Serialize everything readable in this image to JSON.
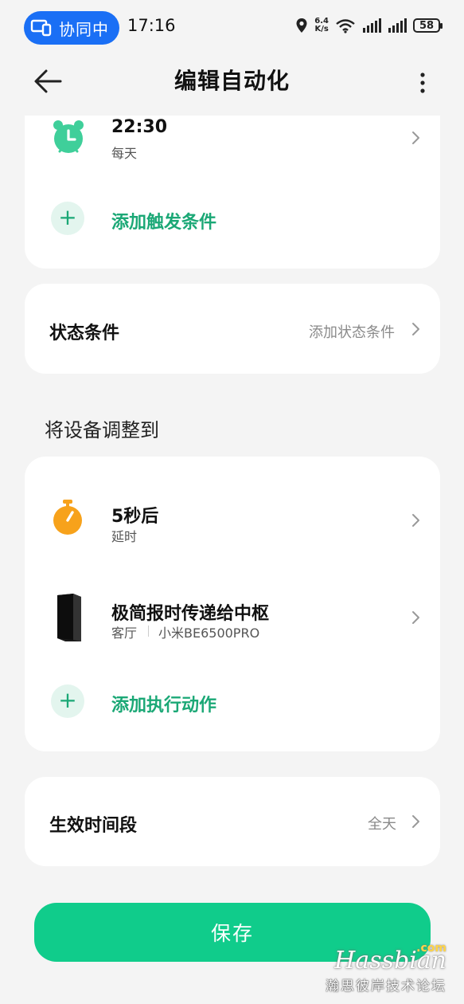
{
  "status_bar": {
    "collab_label": "协同中",
    "time": "17:16",
    "net_speed_value": "6.4",
    "net_speed_unit": "K/s",
    "battery": "58"
  },
  "header": {
    "title": "编辑自动化"
  },
  "trigger_card": {
    "time_trigger": {
      "time": "22:30",
      "repeat": "每天",
      "icon": "alarm-clock-icon"
    },
    "add_trigger_label": "添加触发条件"
  },
  "state_card": {
    "title": "状态条件",
    "hint": "添加状态条件"
  },
  "actions_section": {
    "label": "将设备调整到",
    "items": [
      {
        "title": "5秒后",
        "subtitle": "延时",
        "icon": "stopwatch-icon"
      },
      {
        "title": "极简报时传递给中枢",
        "room": "客厅",
        "device": "小米BE6500PRO",
        "icon": "router-device-icon"
      }
    ],
    "add_action_label": "添加执行动作"
  },
  "effective_card": {
    "title": "生效时间段",
    "value": "全天"
  },
  "save_label": "保存",
  "watermark": {
    "brand": "Hassbian",
    "com": ".com",
    "subtitle": "瀚思彼岸技术论坛"
  },
  "colors": {
    "accent_green": "#1ba876",
    "save_button": "#10cc8b",
    "collab_blue": "#1a6ff5",
    "alarm_green": "#3fcf9a",
    "timer_orange": "#f7a21b"
  }
}
